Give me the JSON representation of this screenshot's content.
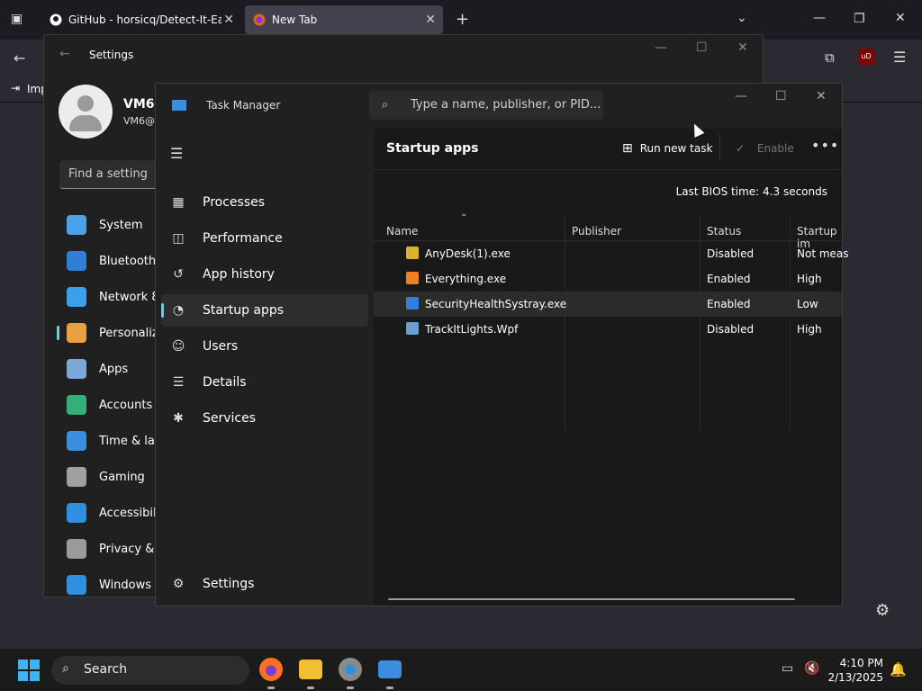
{
  "browser": {
    "tabs": [
      {
        "label": "GitHub - horsicq/Detect-It-Easy",
        "icon": "github-icon",
        "active": false
      },
      {
        "label": "New Tab",
        "icon": "firefox-icon",
        "active": true
      }
    ],
    "bookmark_label": "Imp"
  },
  "settings": {
    "title": "Settings",
    "user_name": "VM6",
    "user_email": "VM6@",
    "search_placeholder": "Find a setting",
    "nav": [
      {
        "label": "System",
        "icon": "system-icon",
        "color": "#4aa3e8"
      },
      {
        "label": "Bluetooth",
        "icon": "bluetooth-icon",
        "color": "#2f7fd8"
      },
      {
        "label": "Network 8",
        "icon": "wifi-icon",
        "color": "#3aa0ea"
      },
      {
        "label": "Personaliza",
        "icon": "brush-icon",
        "color": "#e8a040"
      },
      {
        "label": "Apps",
        "icon": "apps-icon",
        "color": "#7aa8d8"
      },
      {
        "label": "Accounts",
        "icon": "accounts-icon",
        "color": "#33b07a"
      },
      {
        "label": "Time & lar",
        "icon": "time-icon",
        "color": "#3a8ee0"
      },
      {
        "label": "Gaming",
        "icon": "gaming-icon",
        "color": "#a0a0a0"
      },
      {
        "label": "Accessibili",
        "icon": "accessibility-icon",
        "color": "#2f8fe0"
      },
      {
        "label": "Privacy & s",
        "icon": "shield-icon",
        "color": "#9a9a9a"
      },
      {
        "label": "Windows U",
        "icon": "update-icon",
        "color": "#2f8fe0"
      }
    ]
  },
  "taskmanager": {
    "title": "Task Manager",
    "search_placeholder": "Type a name, publisher, or PID...",
    "nav": [
      {
        "label": "Processes",
        "icon": "processes-icon",
        "glyph": "▦"
      },
      {
        "label": "Performance",
        "icon": "performance-icon",
        "glyph": "◫"
      },
      {
        "label": "App history",
        "icon": "history-icon",
        "glyph": "↺"
      },
      {
        "label": "Startup apps",
        "icon": "startup-icon",
        "glyph": "◔"
      },
      {
        "label": "Users",
        "icon": "users-icon",
        "glyph": "☺"
      },
      {
        "label": "Details",
        "icon": "details-icon",
        "glyph": "☰"
      },
      {
        "label": "Services",
        "icon": "services-icon",
        "glyph": "✱"
      }
    ],
    "settings_label": "Settings",
    "page_title": "Startup apps",
    "run_new_task": "Run new task",
    "enable": "Enable",
    "bios_label": "Last BIOS time:",
    "bios_value": "4.3 seconds",
    "columns": [
      "Name",
      "Publisher",
      "Status",
      "Startup im"
    ],
    "rows": [
      {
        "name": "AnyDesk(1).exe",
        "publisher": "",
        "status": "Disabled",
        "impact": "Not meas",
        "icon": "anydesk-icon",
        "color": "#e0b030"
      },
      {
        "name": "Everything.exe",
        "publisher": "",
        "status": "Enabled",
        "impact": "High",
        "icon": "everything-icon",
        "color": "#f08020"
      },
      {
        "name": "SecurityHealthSystray.exe",
        "publisher": "",
        "status": "Enabled",
        "impact": "Low",
        "icon": "security-shield-icon",
        "color": "#2f80e0"
      },
      {
        "name": "TrackItLights.Wpf",
        "publisher": "",
        "status": "Disabled",
        "impact": "High",
        "icon": "app-window-icon",
        "color": "#6aa0d0"
      }
    ]
  },
  "taskbar": {
    "search_label": "Search",
    "time": "4:10 PM",
    "date": "2/13/2025"
  }
}
